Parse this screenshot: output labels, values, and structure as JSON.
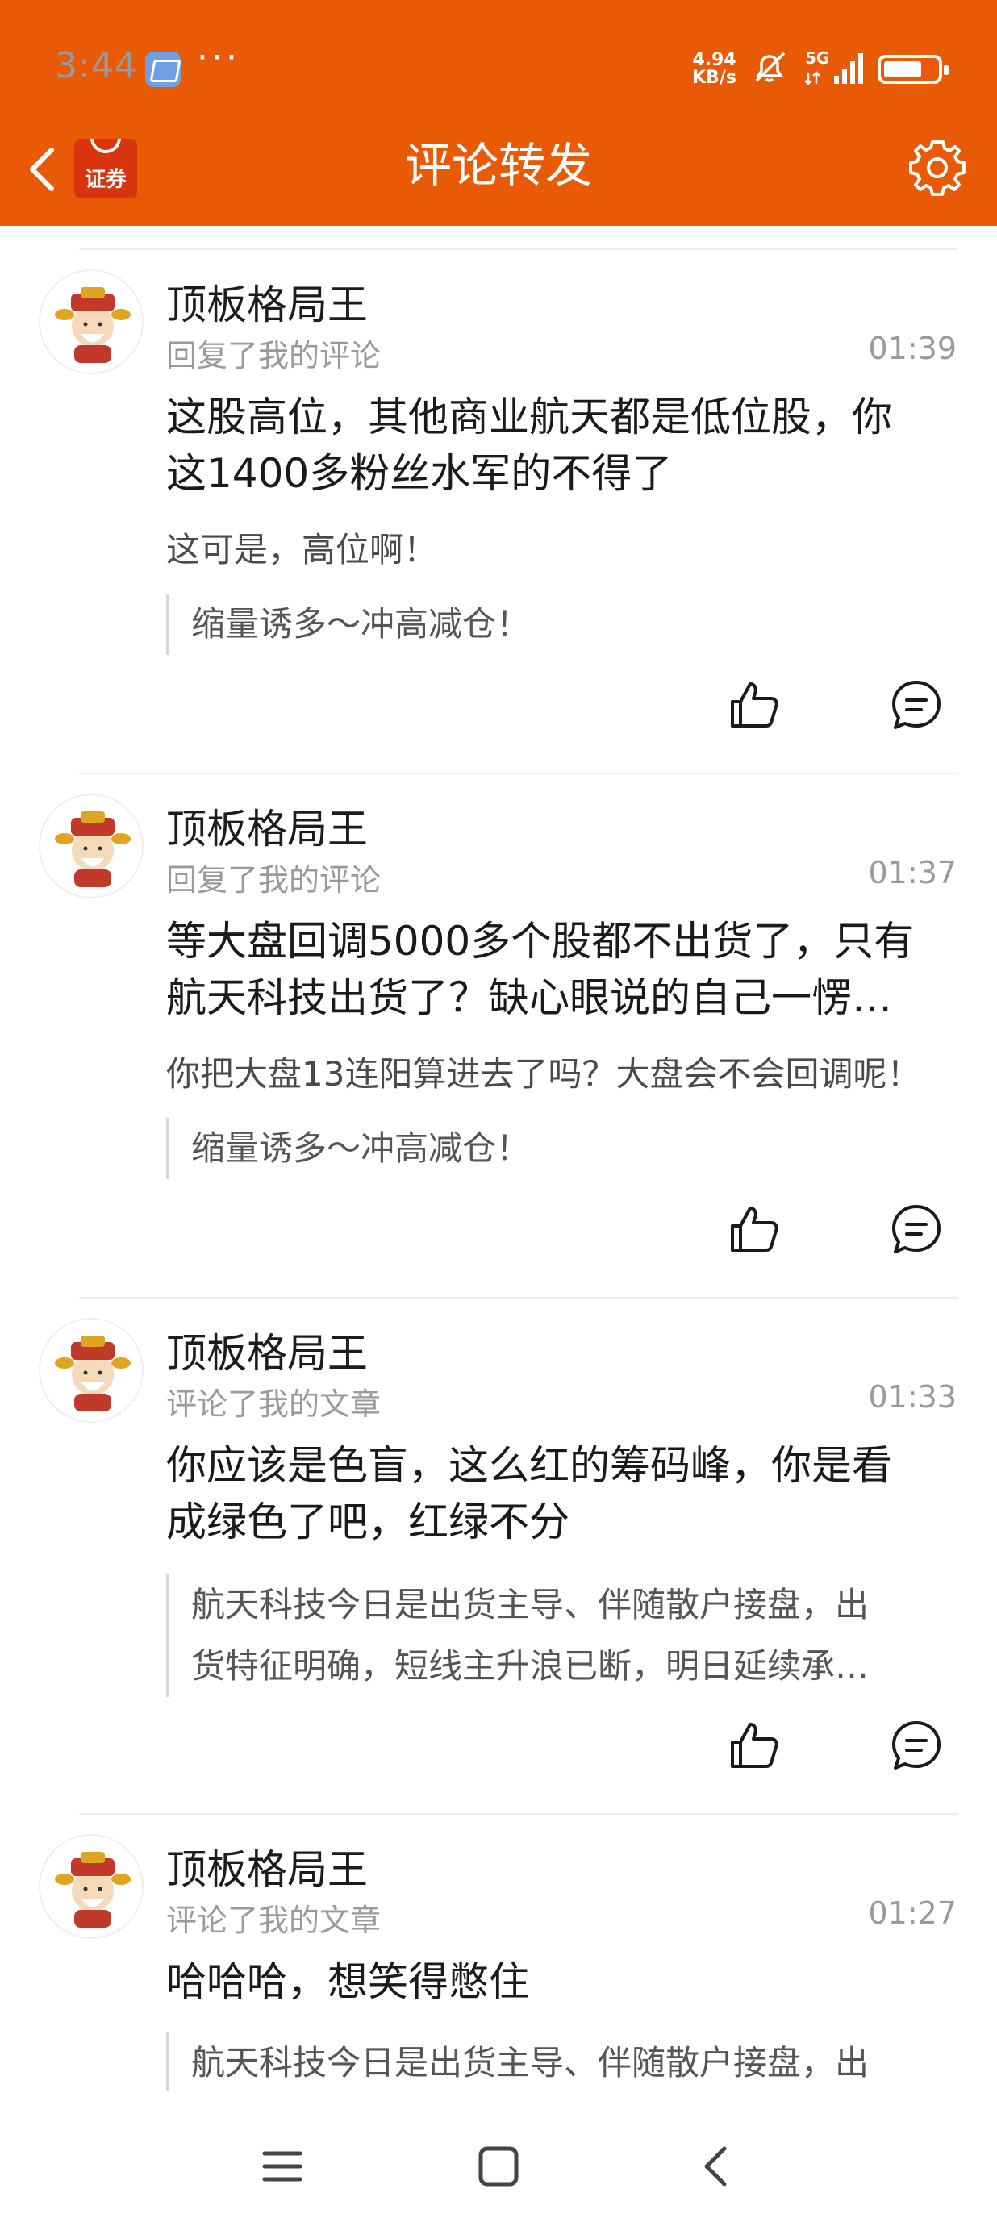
{
  "status_bar": {
    "time": "3:44",
    "more": "···",
    "net_speed_value": "4.94",
    "net_speed_unit": "KB/s",
    "network": "5G"
  },
  "header": {
    "logo_text": "证券",
    "title": "评论转发"
  },
  "feed": [
    {
      "name": "顶板格局王",
      "action": "回复了我的评论",
      "time": "01:39",
      "content_line1": "这股高位，其他商业航天都是低位股，你",
      "content_line2": "这1400多粉丝水军的不得了",
      "reply_text": "这可是，高位啊！",
      "quote_line1": "缩量诱多～冲高减仓！",
      "quote_line2": ""
    },
    {
      "name": "顶板格局王",
      "action": "回复了我的评论",
      "time": "01:37",
      "content_line1": "等大盘回调5000多个股都不出货了，只有",
      "content_line2": "航天科技出货了？缺心眼说的自己一愣…",
      "reply_text": "你把大盘13连阳算进去了吗？大盘会不会回调呢！",
      "quote_line1": "缩量诱多～冲高减仓！",
      "quote_line2": ""
    },
    {
      "name": "顶板格局王",
      "action": "评论了我的文章",
      "time": "01:33",
      "content_line1": "你应该是色盲，这么红的筹码峰，你是看",
      "content_line2": "成绿色了吧，红绿不分",
      "reply_text": "",
      "quote_line1": "航天科技今日是出货主导、伴随散户接盘，出",
      "quote_line2": "货特征明确，短线主升浪已断，明日延续承…"
    },
    {
      "name": "顶板格局王",
      "action": "评论了我的文章",
      "time": "01:27",
      "content_line1": "哈哈哈，想笑得憋住",
      "content_line2": "",
      "reply_text": "",
      "quote_line1": "航天科技今日是出货主导、伴随散户接盘，出",
      "quote_line2": ""
    }
  ],
  "icons": {
    "back": "chevron-left-icon",
    "settings": "gear-icon",
    "like": "thumbs-up-icon",
    "reply": "comment-icon",
    "nav_menu": "menu-icon",
    "nav_home": "home-square-icon",
    "nav_back": "back-triangle-icon"
  },
  "colors": {
    "brand_orange": "#e85a06",
    "logo_red": "#d8350e",
    "secondary_text": "#9a9a9a"
  }
}
